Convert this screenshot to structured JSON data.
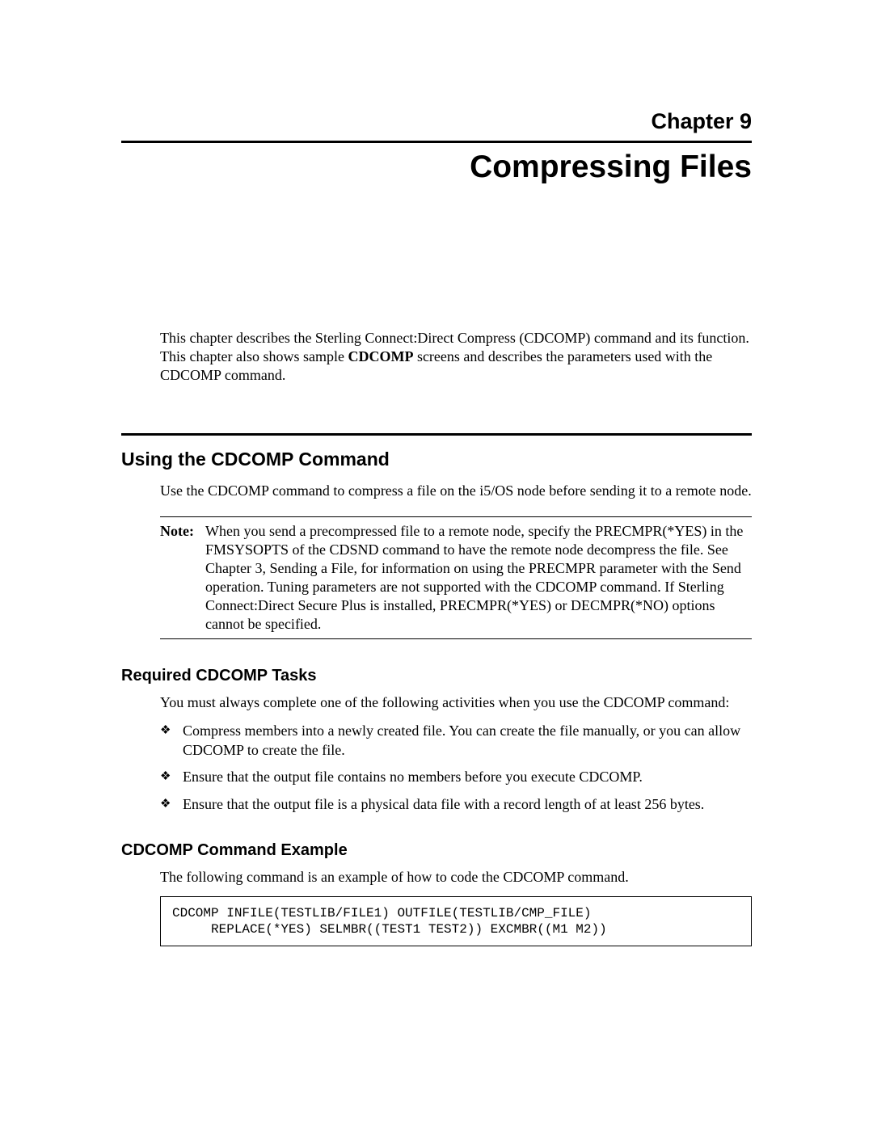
{
  "chapter": {
    "number_label": "Chapter 9",
    "title": "Compressing Files"
  },
  "intro": {
    "a": "This chapter describes the Sterling Connect:Direct Compress (CDCOMP) command and its function. This chapter also shows sample ",
    "b": "CDCOMP",
    "c": " screens and describes the parameters used with the CDCOMP command."
  },
  "section": {
    "title": "Using the CDCOMP Command",
    "para": "Use the CDCOMP command to compress a file on the i5/OS node before sending it to a remote node.",
    "note_label": "Note:",
    "note_body": "When you send a precompressed file to a remote node, specify the PRECMPR(*YES) in the FMSYSOPTS of the CDSND command to have the remote node decompress the file. See Chapter 3, Sending a File, for information on using the PRECMPR parameter with the Send operation. Tuning parameters are not supported with the CDCOMP command. If Sterling Connect:Direct Secure Plus is installed, PRECMPR(*YES) or DECMPR(*NO) options cannot be specified."
  },
  "required": {
    "title": "Required CDCOMP Tasks",
    "para": "You must always complete one of the following activities when you use the CDCOMP command:",
    "items": [
      "Compress members into a newly created file. You can create the file manually, or you can allow CDCOMP to create the file.",
      "Ensure that the output file contains no members before you execute CDCOMP.",
      "Ensure that the output file is a physical data file with a record length of at least 256 bytes."
    ]
  },
  "example": {
    "title": "CDCOMP Command Example",
    "para": "The following command is an example of how to code the CDCOMP command.",
    "code": "CDCOMP INFILE(TESTLIB/FILE1) OUTFILE(TESTLIB/CMP_FILE)\n     REPLACE(*YES) SELMBR((TEST1 TEST2)) EXCMBR((M1 M2))"
  }
}
